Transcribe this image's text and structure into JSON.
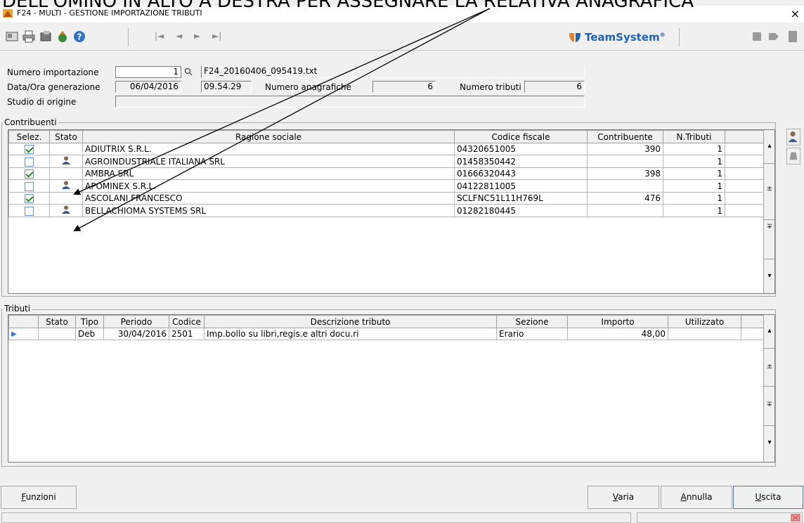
{
  "caption": "DELL'OMINO IN ALTO A DESTRA PER ASSEGNARE LA RELATIVA ANAGRAFICA",
  "window": {
    "title": "F24 - MULTI - GESTIONE IMPORTAZIONE TRIBUTI",
    "close_glyph": "×"
  },
  "toolbar": {
    "nav": [
      "|◄",
      "◄",
      "►",
      "►|"
    ],
    "brand": "TeamSystem",
    "brand_mark": "®"
  },
  "header": {
    "numero_importazione_label": "Numero importazione",
    "numero_importazione_value": "1",
    "file_name": "F24_20160406_095419.txt",
    "data_ora_label": "Data/Ora generazione",
    "data_value": "06/04/2016",
    "ora_value": "09.54.29",
    "numero_anagrafiche_label": "Numero anagrafiche",
    "numero_anagrafiche_value": "6",
    "numero_tributi_label": "Numero tributi",
    "numero_tributi_value": "6",
    "studio_origine_label": "Studio di origine",
    "studio_origine_value": ""
  },
  "contribuenti": {
    "title": "Contribuenti",
    "columns": [
      "Selez.",
      "Stato",
      "Ragione sociale",
      "Codice fiscale",
      "Contribuente",
      "N.Tributi",
      ""
    ],
    "rows": [
      {
        "checked": true,
        "icon": false,
        "ragione": "ADIUTRIX S.R.L.",
        "cf": "04320651005",
        "contribuente": "390",
        "ntributi": "1"
      },
      {
        "checked": false,
        "icon": true,
        "ragione": "AGROINDUSTRIALE ITALIANA SRL",
        "cf": "01458350442",
        "contribuente": "",
        "ntributi": "1"
      },
      {
        "checked": true,
        "icon": false,
        "ragione": "AMBRA SRL",
        "cf": "01666320443",
        "contribuente": "398",
        "ntributi": "1"
      },
      {
        "checked": false,
        "icon": true,
        "ragione": "APOMINEX S.R.L.",
        "cf": "04122811005",
        "contribuente": "",
        "ntributi": "1"
      },
      {
        "checked": true,
        "icon": false,
        "ragione": "ASCOLANI FRANCESCO",
        "cf": "SCLFNC51L11H769L",
        "contribuente": "476",
        "ntributi": "1"
      },
      {
        "checked": false,
        "icon": true,
        "ragione": "BELLACHIOMA SYSTEMS SRL",
        "cf": "01282180445",
        "contribuente": "",
        "ntributi": "1"
      }
    ]
  },
  "tributi": {
    "title": "Tributi",
    "columns": [
      "",
      "Stato",
      "Tipo",
      "Periodo",
      "Codice",
      "Descrizione tributo",
      "Sezione",
      "Importo",
      "Utilizzato",
      ""
    ],
    "rows": [
      {
        "marker": "▶",
        "stato": "",
        "tipo": "Deb",
        "periodo": "30/04/2016",
        "codice": "2501",
        "descrizione": "Imp.bollo su libri,regis.e altri docu.ri",
        "sezione": "Erario",
        "importo": "48,00",
        "utilizzato": ""
      }
    ]
  },
  "buttons": {
    "funzioni": {
      "first": "F",
      "rest": "unzioni"
    },
    "varia": {
      "first": "V",
      "rest": "aria"
    },
    "annulla": {
      "first": "A",
      "rest": "nnulla"
    },
    "uscita": {
      "first": "U",
      "rest": "scita"
    }
  },
  "colors": {
    "brand_blue": "#1c64b4",
    "check_green": "#2f8a2f",
    "selection_blue": "#3a78c8"
  }
}
